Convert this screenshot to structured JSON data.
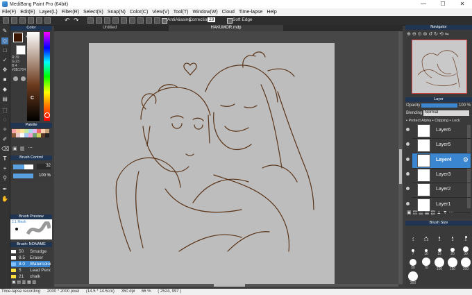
{
  "window": {
    "title": "MediBang Paint Pro (64bit)",
    "min_label": "—",
    "max_label": "☐",
    "close_label": "✕"
  },
  "menu": [
    "File(F)",
    "Edit(E)",
    "Layer(L)",
    "Filter(R)",
    "Select(S)",
    "Snap(N)",
    "Color(C)",
    "View(V)",
    "Tool(T)",
    "Window(W)",
    "Cloud",
    "Time-lapse",
    "Help"
  ],
  "toolbar": {
    "antialiasing_label": "AntiAliasing",
    "correction_label": "Correction",
    "correction_value": "29",
    "soft_edge_label": "Soft Edge"
  },
  "tabs": {
    "untitled": "Untitled",
    "current_file": "HAKUMOR.mdp"
  },
  "color_panel": {
    "title": "Color",
    "r_label": "R:39",
    "g_label": "G:23",
    "b_label": "B:4",
    "hex": "#3B1704",
    "fg_color": "#3b1704",
    "bg_color": "#ffffff",
    "c_label": "C"
  },
  "palette": {
    "title": "Palette",
    "colors": [
      "#f3a5a5",
      "#f6c59b",
      "#f9e39a",
      "#c6e8a2",
      "#a3d8e8",
      "#e0b7f0",
      "#e86a6a",
      "#f7d3b0",
      "#c9a27a",
      "#8a5a3a",
      "#e8c8c8",
      "#ffffff",
      "#a5c8f3",
      "#f39ed0",
      "#70a070",
      "#d0d060",
      "#5a3a2a",
      "#222222"
    ]
  },
  "brush_control": {
    "title": "Brush Control",
    "size_value": "32",
    "opacity_value": "100 %",
    "size_fraction": 0.55,
    "opacity_fraction": 1.0
  },
  "brush_preview": {
    "title": "Brush Preview",
    "size_label": "2.1 Mesh"
  },
  "brush_list": {
    "title": "Brush: NONAME",
    "items": [
      {
        "num": "50",
        "name": "Smudge",
        "color": "#ffffff",
        "active": false
      },
      {
        "num": "8.5",
        "name": "Eraser",
        "color": "#ffffff",
        "active": false
      },
      {
        "num": "8.0",
        "name": "Watercolor",
        "color": "#80c0ff",
        "active": true
      },
      {
        "num": "5",
        "name": "Lead Pencil",
        "color": "#ffe040",
        "active": false
      },
      {
        "num": "21",
        "name": "chalk",
        "color": "#ffe040",
        "active": false
      }
    ]
  },
  "navigator": {
    "title": "Navigator"
  },
  "layer_panel": {
    "title": "Layer",
    "opacity_label": "Opacity",
    "opacity_value": "100 %",
    "blending_label": "Blending",
    "blending_value": "Normal",
    "protect_alpha": "Protect Alpha",
    "clipping": "Clipping",
    "lock": "Lock",
    "layers": [
      {
        "name": "Layer6",
        "active": false
      },
      {
        "name": "Layer5",
        "active": false
      },
      {
        "name": "Layer4",
        "active": true
      },
      {
        "name": "Layer3",
        "active": false
      },
      {
        "name": "Layer2",
        "active": false
      },
      {
        "name": "Layer1",
        "active": false
      }
    ]
  },
  "brush_size": {
    "title": "Brush Size",
    "sizes": [
      "1",
      "1.5",
      "2",
      "3",
      "5",
      "7",
      "10",
      "15",
      "20",
      "30",
      "50",
      "70",
      "100",
      "150",
      "200",
      "300"
    ]
  },
  "status": {
    "recording": "Time-lapse recording",
    "dimensions": "2000 * 2000 pixel",
    "physical": "(14.5 * 14.5cm)",
    "dpi": "350 dpi",
    "zoom": "66 %",
    "coords": "( 2524, 997 )"
  }
}
